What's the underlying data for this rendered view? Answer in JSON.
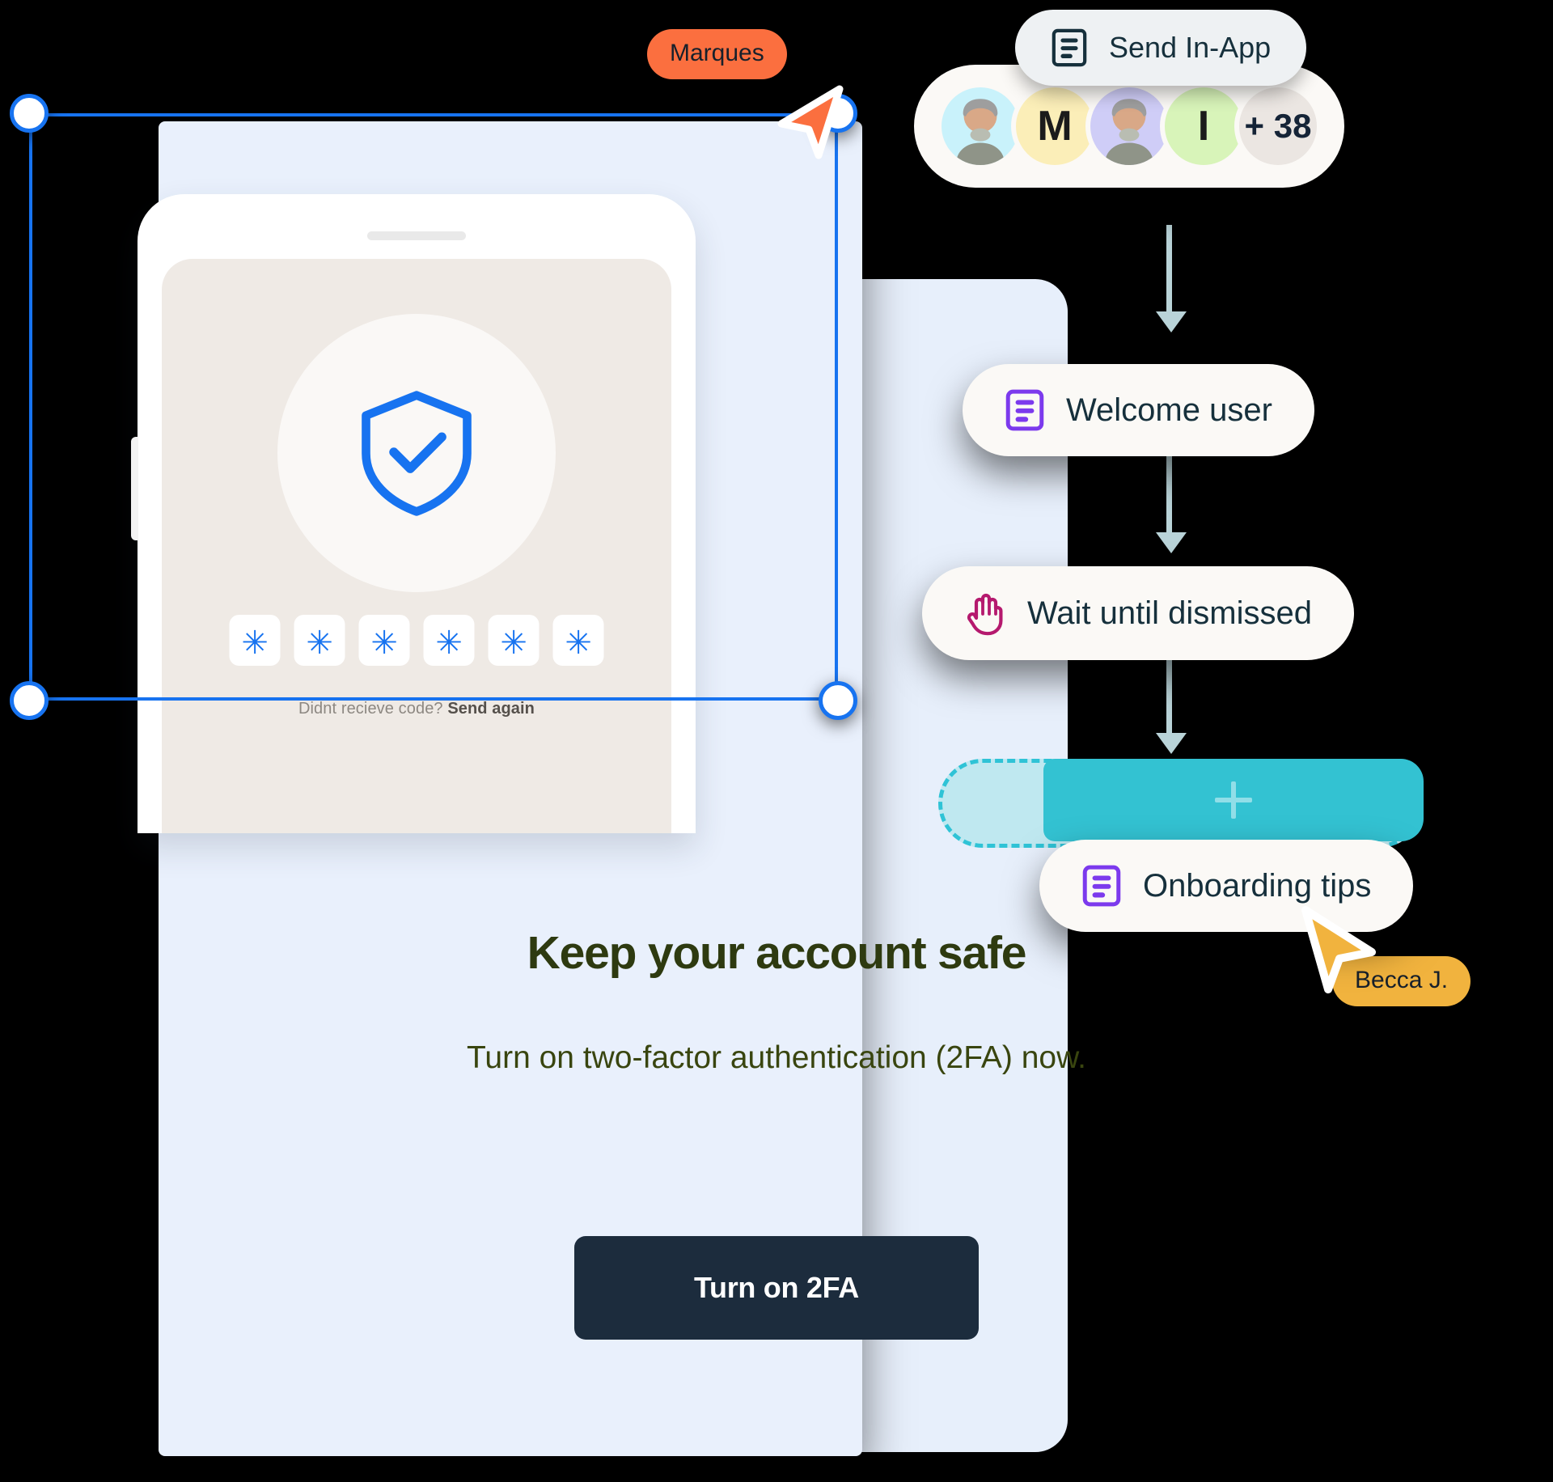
{
  "selection": {
    "author_tag": "Marques",
    "author_tag_color": "#fb6f3f",
    "frame_color": "#1773f0"
  },
  "message_card": {
    "phone": {
      "code_input_count": 6,
      "code_mask_char": "✳",
      "code_mask_color": "#1773f0",
      "shield_icon": "shield-check-icon",
      "resend_prompt": "Didnt recieve code?",
      "resend_link": "Send again"
    },
    "title": "Keep your account safe",
    "subtitle": "Turn on two-factor authentication (2FA) now.",
    "cta_label": "Turn on 2FA",
    "cta_bg": "#1c2c3d",
    "card_bg": "#e9f0fc",
    "title_color": "#2e3a10"
  },
  "flow": {
    "send_step": {
      "label": "Send In-App",
      "icon": "in-app-message-icon",
      "icon_color": "#16303c",
      "bg": "#eef1f3"
    },
    "audience": {
      "avatars": [
        {
          "type": "photo",
          "name": "avatar-photo-1",
          "bg": "#c9f2fb",
          "initial": ""
        },
        {
          "type": "initial",
          "name": "avatar-initial-m",
          "bg": "#fbeeb8",
          "initial": "M"
        },
        {
          "type": "photo",
          "name": "avatar-photo-2",
          "bg": "#cfcdf7",
          "initial": ""
        },
        {
          "type": "initial",
          "name": "avatar-initial-i",
          "bg": "#d8f4b9",
          "initial": "I"
        },
        {
          "type": "count",
          "name": "avatar-overflow",
          "bg": "#ebe6e2",
          "initial": "+ 38"
        }
      ]
    },
    "steps": [
      {
        "label": "Welcome user",
        "icon": "in-app-message-icon",
        "icon_color": "#7c3aed"
      },
      {
        "label": "Wait until dismissed",
        "icon": "hand-stop-icon",
        "icon_color": "#b5196e"
      },
      {
        "label": "Onboarding tips",
        "icon": "in-app-message-icon",
        "icon_color": "#7c3aed"
      }
    ],
    "dropzone": {
      "border_color": "#2fc3d6",
      "fill_color": "#33c2d2",
      "add_icon": "plus-icon"
    },
    "connector_color": "#b9d3d8"
  },
  "collaborator": {
    "name_tag": "Becca J.",
    "tag_color": "#f1b33e",
    "cursor_color": "#f1b33e"
  }
}
